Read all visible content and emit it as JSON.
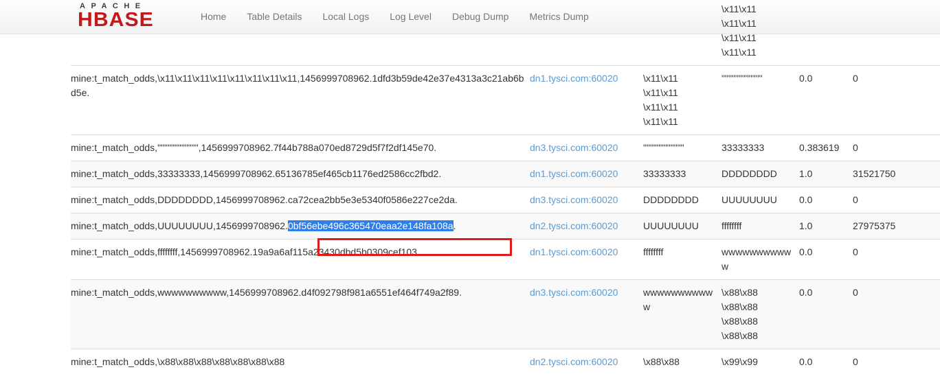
{
  "navbar": {
    "brand": {
      "apache": "APACHE",
      "hbase": "HBASE"
    },
    "links": [
      {
        "label": "Home"
      },
      {
        "label": "Table Details"
      },
      {
        "label": "Local Logs"
      },
      {
        "label": "Log Level"
      },
      {
        "label": "Debug Dump"
      },
      {
        "label": "Metrics Dump"
      }
    ]
  },
  "colors": {
    "brand_red": "#c01b1b",
    "link_blue": "#5b9bd5",
    "selection_blue": "#2f7fe8",
    "annotation_red": "#e01b1b",
    "stripe": "#f9f9f9",
    "border": "#dddddd"
  },
  "annotation": {
    "kind": "red-rectangle-highlight",
    "selected_text": "0bf56ebe496c365470eaa2e148fa108a"
  },
  "table": {
    "rows": [
      {
        "clipped": true,
        "striped": false,
        "name": "",
        "server": "",
        "start_key": "",
        "end_key": "\\x11\\x11\n\\x11\\x11\n\\x11\\x11\n\\x11\\x11",
        "locality": "",
        "requests": ""
      },
      {
        "clipped": false,
        "striped": false,
        "name": "mine:t_match_odds,\\x11\\x11\\x11\\x11\\x11\\x11\\x11\\x11,1456999708962.1dfd3b59de42e37e4313a3c21ab6bd5e.",
        "server": "dn1.tysci.com:60020",
        "start_key": "\\x11\\x11\n\\x11\\x11\n\\x11\\x11\n\\x11\\x11",
        "end_key": "\"\"\"\"\"\"\"\"\"\"\"\"",
        "locality": "0.0",
        "requests": "0"
      },
      {
        "clipped": false,
        "striped": false,
        "name": "mine:t_match_odds,\"\"\"\"\"\"\"\"\"\"\"\",1456999708962.7f44b788a070ed8729d5f7f2df145e70.",
        "server": "dn3.tysci.com:60020",
        "start_key": "\"\"\"\"\"\"\"\"\"\"\"\"",
        "end_key": "33333333",
        "locality": "0.383619",
        "requests": "0"
      },
      {
        "clipped": false,
        "striped": true,
        "name": "mine:t_match_odds,33333333,1456999708962.65136785ef465cb1176ed2586cc2fbd2.",
        "server": "dn1.tysci.com:60020",
        "start_key": "33333333",
        "end_key": "DDDDDDDD",
        "locality": "1.0",
        "requests": "31521750"
      },
      {
        "clipped": false,
        "striped": false,
        "name": "mine:t_match_odds,DDDDDDDD,1456999708962.ca72cea2bb5e3e5340f0586e227ce2da.",
        "server": "dn3.tysci.com:60020",
        "start_key": "DDDDDDDD",
        "end_key": "UUUUUUUU",
        "locality": "0.0",
        "requests": "0"
      },
      {
        "clipped": false,
        "striped": true,
        "highlighted": true,
        "name_prefix": "mine:t_match_odds,UUUUUUUU,1456999708962.",
        "name_selected": "0bf56ebe496c365470eaa2e148fa108a",
        "name_suffix": ".",
        "name": "mine:t_match_odds,UUUUUUUU,1456999708962.0bf56ebe496c365470eaa2e148fa108a.",
        "server": "dn2.tysci.com:60020",
        "start_key": "UUUUUUUU",
        "end_key": "ffffffff",
        "locality": "1.0",
        "requests": "27975375"
      },
      {
        "clipped": false,
        "striped": false,
        "name": "mine:t_match_odds,ffffffff,1456999708962.19a9a6af115a23430dbd5b0309cef103.",
        "server": "dn1.tysci.com:60020",
        "start_key": "ffffffff",
        "end_key": "wwwwwwwwwww",
        "locality": "0.0",
        "requests": "0"
      },
      {
        "clipped": false,
        "striped": true,
        "name": "mine:t_match_odds,wwwwwwwwww,1456999708962.d4f092798f981a6551ef464f749a2f89.",
        "server": "dn3.tysci.com:60020",
        "start_key": "wwwwwwwwwww",
        "end_key": "\\x88\\x88\n\\x88\\x88\n\\x88\\x88\n\\x88\\x88",
        "locality": "0.0",
        "requests": "0"
      },
      {
        "clipped": false,
        "striped": false,
        "name": "mine:t_match_odds,\\x88\\x88\\x88\\x88\\x88\\x88\\x88",
        "server": "dn2.tysci.com:60020",
        "start_key": "\\x88\\x88",
        "end_key": "\\x99\\x99",
        "locality": "0.0",
        "requests": "0"
      }
    ]
  }
}
